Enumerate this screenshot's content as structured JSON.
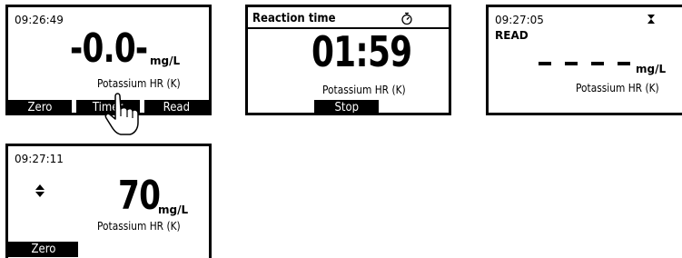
{
  "screen1": {
    "time": "09:26:49",
    "value": "-0.0-",
    "unit": "mg/L",
    "parameter": "Potassium HR (K)",
    "softkeys": [
      "Zero",
      "Timer",
      "Read"
    ]
  },
  "screen2": {
    "title": "Reaction time",
    "timer_icon": "stopwatch-icon",
    "countdown": "01:59",
    "parameter": "Potassium HR (K)",
    "softkey": "Stop"
  },
  "screen3": {
    "time": "09:27:05",
    "hourglass_icon": "hourglass-icon",
    "status": "READ",
    "unit": "mg/L",
    "parameter": "Potassium HR (K)"
  },
  "screen4": {
    "time": "09:27:11",
    "arrows_icon": "up-down-arrows-icon",
    "value": "70",
    "unit": "mg/L",
    "parameter": "Potassium HR (K)",
    "softkey": "Zero"
  }
}
